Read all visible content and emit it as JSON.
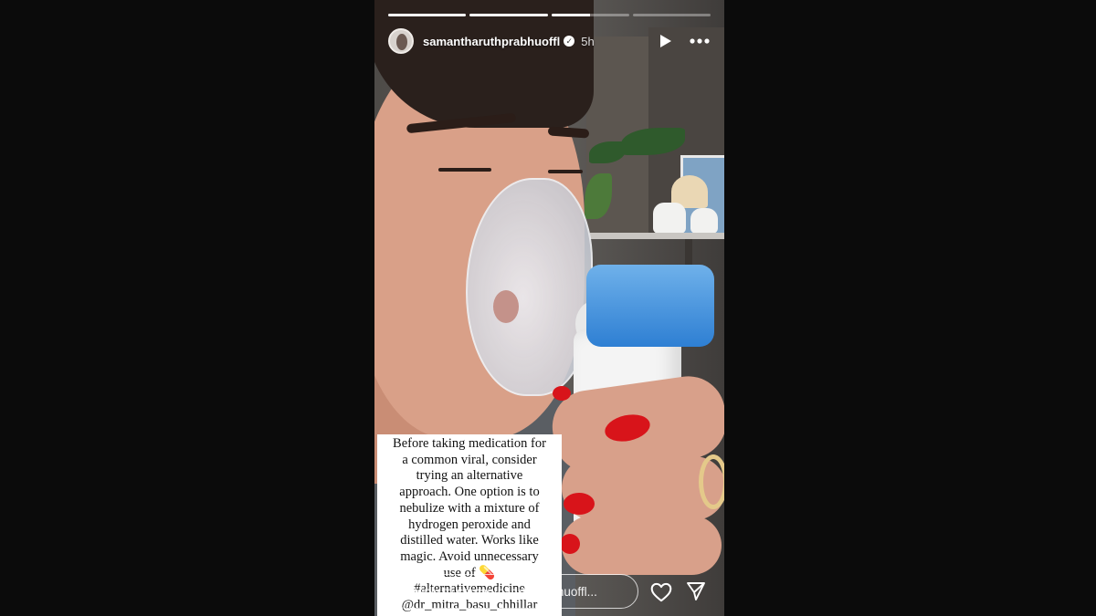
{
  "story": {
    "progress": [
      1,
      1,
      0.5,
      0
    ],
    "username": "samantharuthprabhuoffl",
    "time_ago": "5h",
    "caption_lines": [
      "Before taking medication for",
      "a common viral, consider",
      "trying an alternative",
      "approach. One option is to",
      "nebulize with a mixture of",
      "hydrogen peroxide and",
      "distilled water. Works like",
      "magic. Avoid unnecessary",
      "use of 💊",
      "#alternativemedicine",
      "@dr_mitra_basu_chhillar"
    ],
    "reply_placeholder": "Reply to samantharuthprabhuoffl..."
  },
  "icons": [
    "verified-icon",
    "play-icon",
    "more-icon",
    "heart-icon",
    "send-icon"
  ],
  "colors": {
    "background": "#0b0b0b",
    "nail": "#d8141a",
    "device_cap": "#2e7fd3"
  }
}
